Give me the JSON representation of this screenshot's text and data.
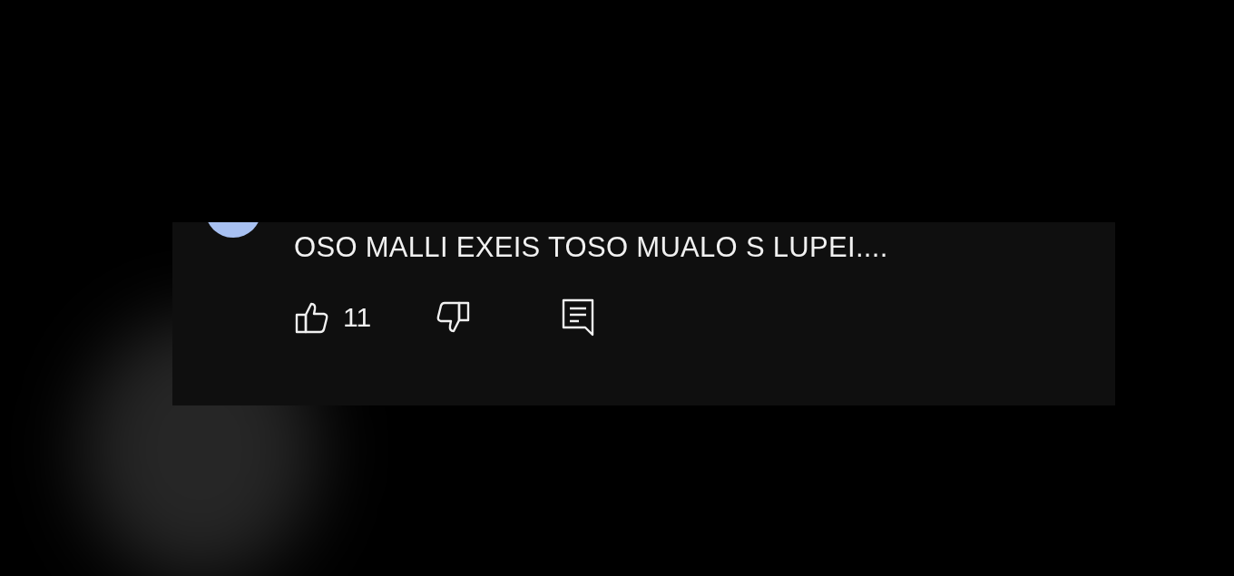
{
  "comment": {
    "text": "OSO MALLI EXEIS TOSO MUALO S LUPEI....",
    "like_count": "11",
    "liked": false,
    "disliked": false
  }
}
